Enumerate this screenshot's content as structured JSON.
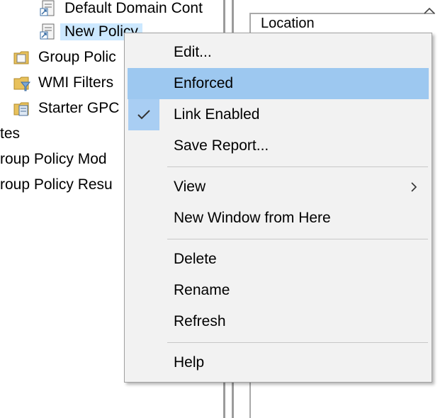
{
  "tree": {
    "items": [
      {
        "label": "Default Domain Cont",
        "icon": "gpo-link-icon"
      },
      {
        "label": "New Policy",
        "icon": "gpo-link-icon",
        "selected": true
      },
      {
        "label": "Group Polic",
        "icon": "folder-icon"
      },
      {
        "label": "WMI Filters",
        "icon": "wmi-filter-folder-icon"
      },
      {
        "label": "Starter GPC",
        "icon": "starter-gpo-folder-icon"
      },
      {
        "label": "tes"
      },
      {
        "label": "roup Policy Mod"
      },
      {
        "label": "roup Policy Resu"
      }
    ]
  },
  "details": {
    "column_header": "Location",
    "sort_icon": "chevron-up-icon"
  },
  "context_menu": {
    "items": [
      {
        "label": "Edit...",
        "highlighted": false,
        "checked": false
      },
      {
        "label": "Enforced",
        "highlighted": true,
        "checked": false
      },
      {
        "label": "Link Enabled",
        "highlighted": false,
        "checked": true
      },
      {
        "label": "Save Report...",
        "highlighted": false,
        "checked": false
      },
      {
        "label": "View",
        "highlighted": false,
        "checked": false,
        "submenu": true
      },
      {
        "label": "New Window from Here",
        "highlighted": false,
        "checked": false
      },
      {
        "label": "Delete",
        "highlighted": false,
        "checked": false
      },
      {
        "label": "Rename",
        "highlighted": false,
        "checked": false
      },
      {
        "label": "Refresh",
        "highlighted": false,
        "checked": false
      },
      {
        "label": "Help",
        "highlighted": false,
        "checked": false
      }
    ],
    "colors": {
      "highlight": "#9dc8f0",
      "check_background": "#a9cef3",
      "menu_background": "#f2f2f2"
    }
  }
}
